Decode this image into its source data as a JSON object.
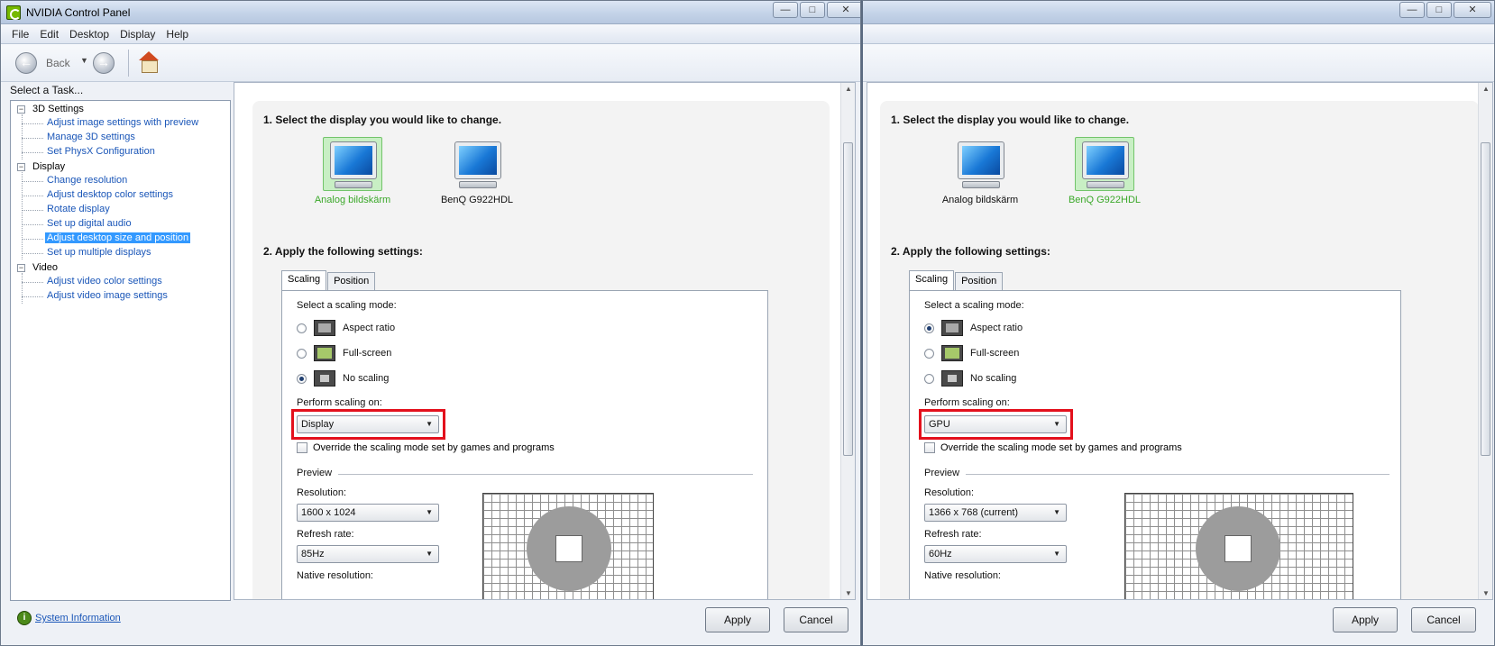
{
  "window": {
    "title": "NVIDIA Control Panel",
    "controls": {
      "minimize": "—",
      "maximize": "□",
      "close": "✕"
    }
  },
  "menu": [
    "File",
    "Edit",
    "Desktop",
    "Display",
    "Help"
  ],
  "toolbar": {
    "back_label": "Back",
    "back_icon": "arrow-left-icon",
    "forward_icon": "arrow-right-icon",
    "home_icon": "home-icon"
  },
  "task_panel": {
    "header": "Select a Task...",
    "groups": [
      {
        "label": "3D Settings",
        "items": [
          "Adjust image settings with preview",
          "Manage 3D settings",
          "Set PhysX Configuration"
        ]
      },
      {
        "label": "Display",
        "items": [
          "Change resolution",
          "Adjust desktop color settings",
          "Rotate display",
          "Set up digital audio",
          "Adjust desktop size and position",
          "Set up multiple displays"
        ]
      },
      {
        "label": "Video",
        "items": [
          "Adjust video color settings",
          "Adjust video image settings"
        ]
      }
    ],
    "selected_item": "Adjust desktop size and position",
    "system_info": "System Information"
  },
  "content": {
    "step1": "1. Select the display you would like to change.",
    "step2": "2. Apply the following settings:",
    "tabs": [
      "Scaling",
      "Position"
    ],
    "scaling_mode_label": "Select a scaling mode:",
    "modes": [
      "Aspect ratio",
      "Full-screen",
      "No scaling"
    ],
    "perform_label": "Perform scaling on:",
    "override_label": "Override the scaling mode set by games and programs",
    "preview_label": "Preview",
    "resolution_label": "Resolution:",
    "refresh_label": "Refresh rate:",
    "native_label": "Native resolution:"
  },
  "panes": [
    {
      "displays": [
        {
          "name": "Analog bildskärm",
          "selected": true
        },
        {
          "name": "BenQ G922HDL",
          "selected": false
        }
      ],
      "selected_mode": "No scaling",
      "perform_on": "Display",
      "resolution": "1600 x 1024",
      "refresh": "85Hz"
    },
    {
      "displays": [
        {
          "name": "Analog bildskärm",
          "selected": false
        },
        {
          "name": "BenQ G922HDL",
          "selected": true
        }
      ],
      "selected_mode": "Aspect ratio",
      "perform_on": "GPU",
      "resolution": "1366 x 768 (current)",
      "refresh": "60Hz"
    }
  ],
  "buttons": {
    "apply": "Apply",
    "cancel": "Cancel"
  },
  "colors": {
    "highlight": "#e3101c",
    "link": "#1a56b8",
    "selection": "#3399ff",
    "active_display": "#3aa829"
  }
}
